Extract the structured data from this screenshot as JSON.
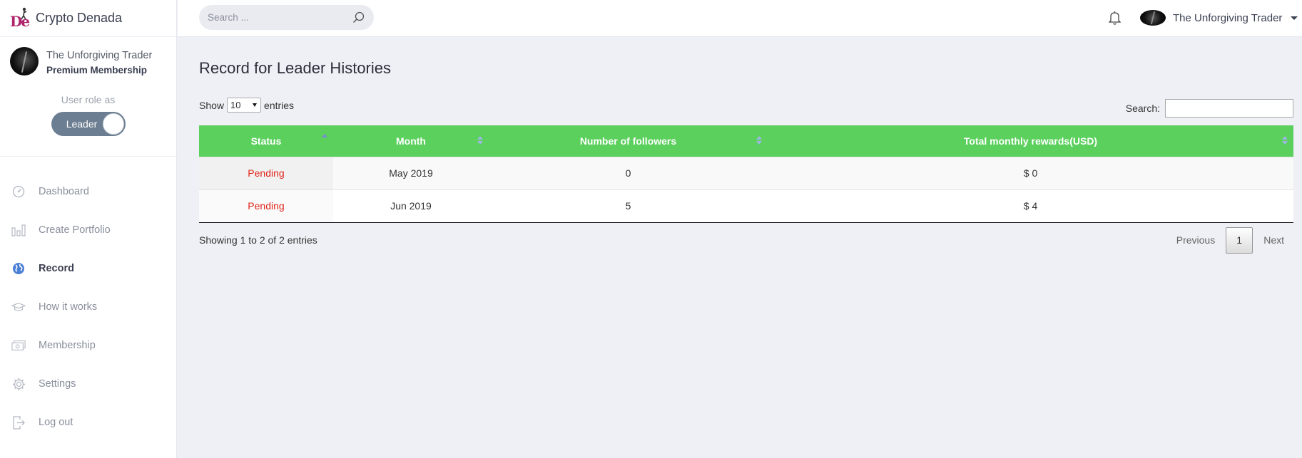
{
  "brand": {
    "logo_text": "De",
    "name": "Crypto Denada"
  },
  "profile": {
    "name": "The Unforgiving Trader",
    "plan": "Premium Membership",
    "role_label": "User role as",
    "role_toggle": "Leader"
  },
  "nav": [
    {
      "label": "Dashboard",
      "icon": "dashboard-gauge-icon"
    },
    {
      "label": "Create Portfolio",
      "icon": "bar-chart-icon"
    },
    {
      "label": "Record",
      "icon": "globe-icon",
      "active": true
    },
    {
      "label": "How it works",
      "icon": "graduation-cap-icon"
    },
    {
      "label": "Membership",
      "icon": "money-icon"
    },
    {
      "label": "Settings",
      "icon": "gear-icon"
    },
    {
      "label": "Log out",
      "icon": "logout-icon"
    }
  ],
  "topbar": {
    "search_placeholder": "Search ...",
    "user_name": "The Unforgiving Trader"
  },
  "page": {
    "title": "Record for Leader Histories",
    "show_label": "Show",
    "show_value": "10",
    "entries_label": "entries",
    "search_label": "Search:",
    "columns": [
      "Status",
      "Month",
      "Number of followers",
      "Total monthly rewards(USD)"
    ],
    "rows": [
      {
        "status": "Pending",
        "month": "May 2019",
        "followers": "0",
        "rewards": "$ 0"
      },
      {
        "status": "Pending",
        "month": "Jun 2019",
        "followers": "5",
        "rewards": "$ 4"
      }
    ],
    "info": "Showing 1 to 2 of 2 entries",
    "pagination": {
      "previous": "Previous",
      "current": "1",
      "next": "Next"
    }
  },
  "colors": {
    "header_green": "#5bd05d",
    "pending_red": "#e0251b",
    "active_blue": "#4a7fd6",
    "brand_magenta": "#b0256e"
  }
}
